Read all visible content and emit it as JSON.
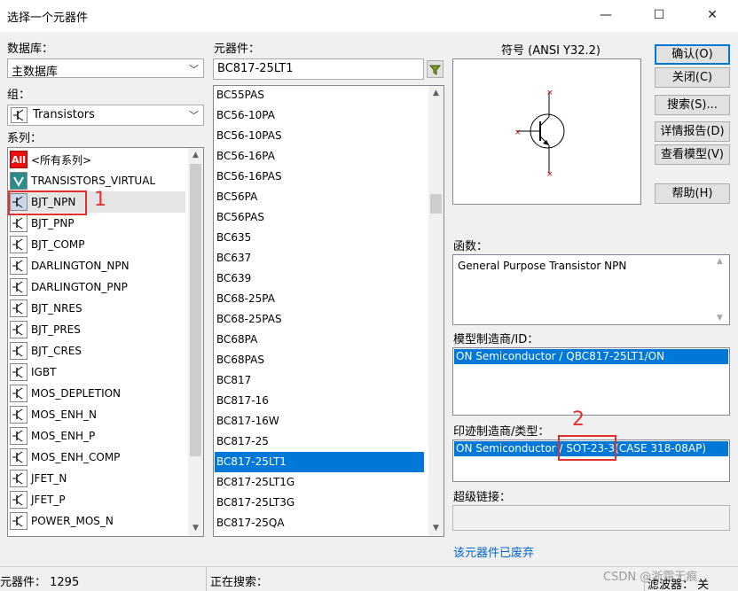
{
  "window": {
    "title": "选择一个元器件",
    "minimize": "—",
    "maximize": "☐",
    "close": "✕"
  },
  "left": {
    "database_label": "数据库：",
    "database_value": "主数据库",
    "group_label": "组：",
    "group_value": "Transistors",
    "series_label": "系列：",
    "series": [
      {
        "label": "<所有系列>",
        "icon": "all-icon"
      },
      {
        "label": "TRANSISTORS_VIRTUAL",
        "icon": "transistor-virtual-icon"
      },
      {
        "label": "BJT_NPN",
        "icon": "bjt-npn-icon"
      },
      {
        "label": "BJT_PNP",
        "icon": "bjt-pnp-icon"
      },
      {
        "label": "BJT_COMP",
        "icon": "bjt-comp-icon"
      },
      {
        "label": "DARLINGTON_NPN",
        "icon": "darlington-npn-icon"
      },
      {
        "label": "DARLINGTON_PNP",
        "icon": "darlington-pnp-icon"
      },
      {
        "label": "BJT_NRES",
        "icon": "bjt-nres-icon"
      },
      {
        "label": "BJT_PRES",
        "icon": "bjt-pres-icon"
      },
      {
        "label": "BJT_CRES",
        "icon": "bjt-cres-icon"
      },
      {
        "label": "IGBT",
        "icon": "igbt-icon"
      },
      {
        "label": "MOS_DEPLETION",
        "icon": "mos-depletion-icon"
      },
      {
        "label": "MOS_ENH_N",
        "icon": "mos-enh-n-icon"
      },
      {
        "label": "MOS_ENH_P",
        "icon": "mos-enh-p-icon"
      },
      {
        "label": "MOS_ENH_COMP",
        "icon": "mos-enh-comp-icon"
      },
      {
        "label": "JFET_N",
        "icon": "jfet-n-icon"
      },
      {
        "label": "JFET_P",
        "icon": "jfet-p-icon"
      },
      {
        "label": "POWER_MOS_N",
        "icon": "power-mos-n-icon"
      }
    ],
    "all_badge": "All"
  },
  "middle": {
    "component_label": "元器件：",
    "component_value": "BC817-25LT1",
    "components": [
      "BC55PAS",
      "BC56-10PA",
      "BC56-10PAS",
      "BC56-16PA",
      "BC56-16PAS",
      "BC56PA",
      "BC56PAS",
      "BC635",
      "BC637",
      "BC639",
      "BC68-25PA",
      "BC68-25PAS",
      "BC68PA",
      "BC68PAS",
      "BC817",
      "BC817-16",
      "BC817-16W",
      "BC817-25",
      "BC817-25LT1",
      "BC817-25LT1G",
      "BC817-25LT3G",
      "BC817-25QA"
    ],
    "selected_component": "BC817-25LT1"
  },
  "right": {
    "symbol_label": "符号 (ANSI Y32.2)",
    "function_label": "函数：",
    "function_value": "General Purpose Transistor NPN",
    "model_label": "模型制造商/ID：",
    "model_value": "ON Semiconductor / QBC817-25LT1/ON",
    "footprint_label": "印迹制造商/类型：",
    "footprint_prefix": "ON Semiconductor / ",
    "footprint_pkg": "SOT-23-3",
    "footprint_suffix": "(CASE 318-08AP)",
    "hyperlink_label": "超级链接：",
    "hyperlink_value": "",
    "deprecated_text": "该元器件已废弃"
  },
  "buttons": {
    "ok": "确认(O)",
    "close": "关闭(C)",
    "search": "搜索(S)...",
    "detail": "详情报告(D)",
    "view_model": "查看模型(V)",
    "help": "帮助(H)"
  },
  "annotations": {
    "marker_1": "1",
    "marker_2": "2"
  },
  "status": {
    "count_text": "元器件：  1295",
    "searching_text": "正在搜索：",
    "watermark": "CSDN @浙霜无痕",
    "filter_text": "滤波器：  关"
  },
  "colors": {
    "selection": "#0078d7",
    "annotation": "#e03030",
    "link": "#0066cc"
  }
}
